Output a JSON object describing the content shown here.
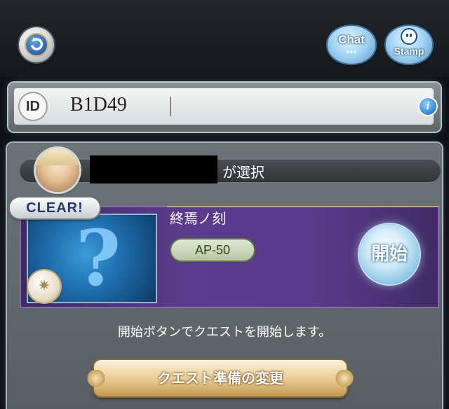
{
  "header": {
    "refresh_icon": "refresh-icon",
    "chat_label": "Chat",
    "chat_dots": "•••",
    "stamp_label": "Stamp",
    "stamp_icon": "smiley-face-icon"
  },
  "id_entry": {
    "badge": "ID",
    "value": "B1D49",
    "info_icon": "info-icon"
  },
  "selection": {
    "selected_suffix": "が選択"
  },
  "quest": {
    "clear_badge": "CLEAR!",
    "title": "終焉ノ刻",
    "ap_cost": "AP-50",
    "start_label": "開始",
    "element_icon": "light-element-icon"
  },
  "hint": "開始ボタンでクエストを開始します。",
  "prep_button": "クエスト準備の変更"
}
